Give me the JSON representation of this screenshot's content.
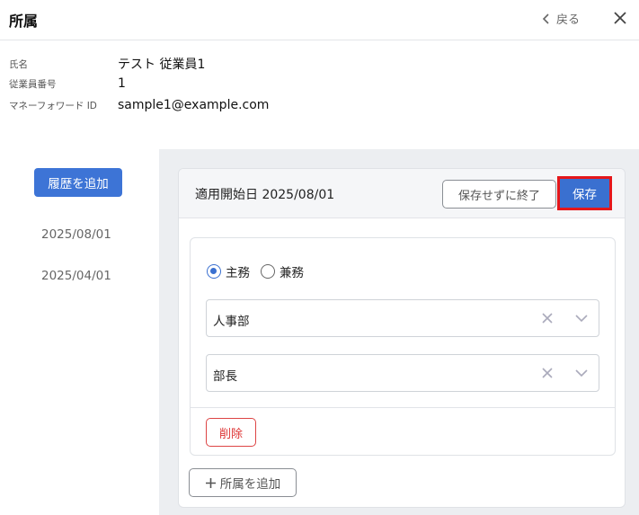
{
  "header": {
    "title": "所属",
    "back_label": "戻る"
  },
  "info": [
    {
      "label": "氏名",
      "value": "テスト 従業員1"
    },
    {
      "label": "従業員番号",
      "value": "1"
    },
    {
      "label": "マネーフォワード ID",
      "value": "sample1@example.com"
    }
  ],
  "history": {
    "add_label": "履歴を追加",
    "dates": [
      "2025/08/01",
      "2025/04/01"
    ]
  },
  "editor": {
    "title": "適用開始日 2025/08/01",
    "exit_without_save_label": "保存せずに終了",
    "save_label": "保存",
    "radio_primary": "主務",
    "radio_secondary": "兼務",
    "department_value": "人事部",
    "position_value": "部長",
    "delete_label": "削除",
    "add_affiliation_label": "所属を追加"
  },
  "colors": {
    "primary": "#3a70d0",
    "highlight": "#e5171b",
    "danger": "#d33333"
  }
}
